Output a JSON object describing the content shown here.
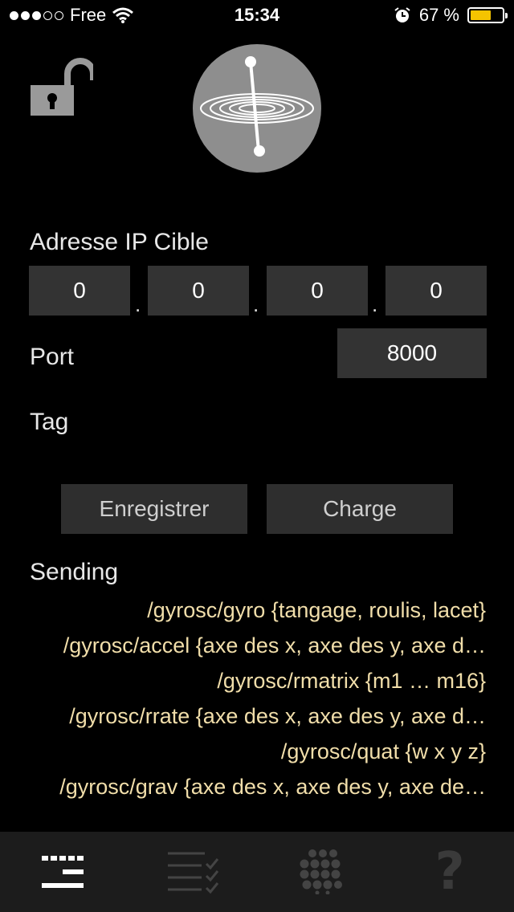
{
  "status_bar": {
    "carrier": "Free",
    "time": "15:34",
    "battery": "67 %",
    "battery_level": 0.67,
    "icons": [
      "signal-dots-icon",
      "wifi-icon",
      "alarm-icon",
      "battery-icon"
    ]
  },
  "header": {
    "lock_icon": "unlocked-padlock-icon",
    "logo_icon": "gyroscope-logo-icon"
  },
  "ip": {
    "label": "Adresse IP Cible",
    "octets": [
      "0",
      "0",
      "0",
      "0"
    ],
    "separator": "."
  },
  "port": {
    "label": "Port",
    "value": "8000"
  },
  "tag": {
    "label": "Tag",
    "value": ""
  },
  "actions": {
    "save_label": "Enregistrer",
    "load_label": "Charge"
  },
  "sending": {
    "title": "Sending",
    "lines": [
      "/gyrosc/gyro {tangage, roulis, lacet}",
      "/gyrosc/accel {axe des x, axe des y, axe d…",
      "/gyrosc/rmatrix {m1 … m16}",
      "/gyrosc/rrate {axe des x, axe des y, axe d…",
      "/gyrosc/quat {w x y z}",
      "/gyrosc/grav {axe des x, axe des y, axe de…"
    ]
  },
  "tabbar": {
    "tabs": [
      "settings-tab",
      "checklist-tab",
      "dots-grid-tab",
      "help-tab"
    ],
    "help_glyph": "?",
    "active_color": "#ffffff",
    "inactive_color": "#3a3a3a"
  }
}
